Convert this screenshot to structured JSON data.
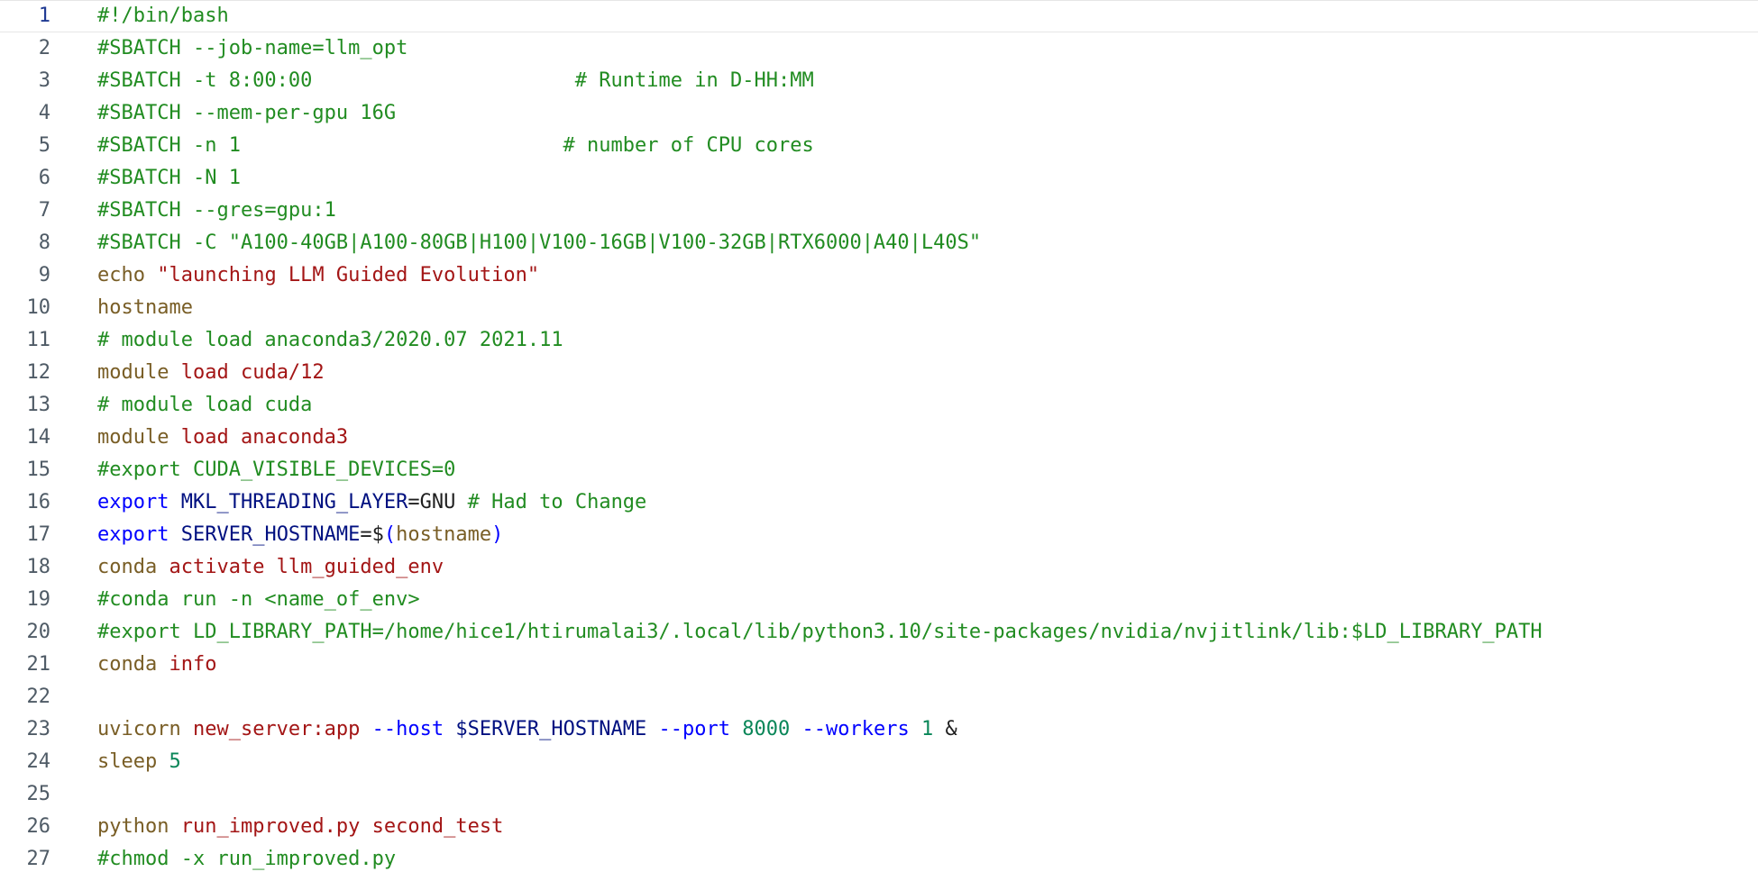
{
  "colors": {
    "comment": "#218c21",
    "keyword": "#795e26",
    "string": "#a31515",
    "flag": "#0000ff",
    "variable": "#001080",
    "number": "#098658",
    "plain": "#1f1f1f",
    "line_number": "#4f5b66",
    "background": "#ffffff"
  },
  "lines": [
    {
      "num": "1",
      "tokens": [
        {
          "t": "#!/bin/bash",
          "c": "cm"
        }
      ]
    },
    {
      "num": "2",
      "tokens": [
        {
          "t": "#SBATCH --job-name=llm_opt",
          "c": "cm"
        }
      ]
    },
    {
      "num": "3",
      "tokens": [
        {
          "t": "#SBATCH -t 8:00:00                      # Runtime in D-HH:MM",
          "c": "cm"
        }
      ]
    },
    {
      "num": "4",
      "tokens": [
        {
          "t": "#SBATCH --mem-per-gpu 16G",
          "c": "cm"
        }
      ]
    },
    {
      "num": "5",
      "tokens": [
        {
          "t": "#SBATCH -n 1                           # number of CPU cores",
          "c": "cm"
        }
      ]
    },
    {
      "num": "6",
      "tokens": [
        {
          "t": "#SBATCH -N 1",
          "c": "cm"
        }
      ]
    },
    {
      "num": "7",
      "tokens": [
        {
          "t": "#SBATCH --gres=gpu:1",
          "c": "cm"
        }
      ]
    },
    {
      "num": "8",
      "tokens": [
        {
          "t": "#SBATCH -C \"A100-40GB|A100-80GB|H100|V100-16GB|V100-32GB|RTX6000|A40|L40S\"",
          "c": "cm"
        }
      ]
    },
    {
      "num": "9",
      "tokens": [
        {
          "t": "echo",
          "c": "ckw"
        },
        {
          "t": " ",
          "c": "cplain"
        },
        {
          "t": "\"launching LLM Guided Evolution\"",
          "c": "cstr"
        }
      ]
    },
    {
      "num": "10",
      "tokens": [
        {
          "t": "hostname",
          "c": "ckw"
        }
      ]
    },
    {
      "num": "11",
      "tokens": [
        {
          "t": "# module load anaconda3/2020.07 2021.11",
          "c": "cm"
        }
      ]
    },
    {
      "num": "12",
      "tokens": [
        {
          "t": "module",
          "c": "ckw"
        },
        {
          "t": " load cuda/12",
          "c": "cstr"
        }
      ]
    },
    {
      "num": "13",
      "tokens": [
        {
          "t": "# module load cuda",
          "c": "cm"
        }
      ]
    },
    {
      "num": "14",
      "tokens": [
        {
          "t": "module",
          "c": "ckw"
        },
        {
          "t": " load anaconda3",
          "c": "cstr"
        }
      ]
    },
    {
      "num": "15",
      "tokens": [
        {
          "t": "#export CUDA_VISIBLE_DEVICES=0",
          "c": "cm"
        }
      ]
    },
    {
      "num": "16",
      "tokens": [
        {
          "t": "export",
          "c": "cblue"
        },
        {
          "t": " MKL_THREADING_LAYER",
          "c": "cnavy"
        },
        {
          "t": "=GNU ",
          "c": "cplain"
        },
        {
          "t": "# Had to Change",
          "c": "cm"
        }
      ]
    },
    {
      "num": "17",
      "tokens": [
        {
          "t": "export",
          "c": "cblue"
        },
        {
          "t": " SERVER_HOSTNAME",
          "c": "cnavy"
        },
        {
          "t": "=$",
          "c": "cplain"
        },
        {
          "t": "(",
          "c": "cblue"
        },
        {
          "t": "hostname",
          "c": "ckw"
        },
        {
          "t": ")",
          "c": "cblue"
        }
      ]
    },
    {
      "num": "18",
      "tokens": [
        {
          "t": "conda",
          "c": "ckw"
        },
        {
          "t": " activate llm_guided_env",
          "c": "cstr"
        }
      ]
    },
    {
      "num": "19",
      "tokens": [
        {
          "t": "#conda run -n <name_of_env>",
          "c": "cm"
        }
      ]
    },
    {
      "num": "20",
      "tokens": [
        {
          "t": "#export LD_LIBRARY_PATH=/home/hice1/htirumalai3/.local/lib/python3.10/site-packages/nvidia/nvjitlink/lib:$LD_LIBRARY_PATH",
          "c": "cm"
        }
      ]
    },
    {
      "num": "21",
      "tokens": [
        {
          "t": "conda",
          "c": "ckw"
        },
        {
          "t": " info",
          "c": "cstr"
        }
      ]
    },
    {
      "num": "22",
      "tokens": []
    },
    {
      "num": "23",
      "tokens": [
        {
          "t": "uvicorn",
          "c": "ckw"
        },
        {
          "t": " new_server:app ",
          "c": "cstr"
        },
        {
          "t": "--host",
          "c": "cblue"
        },
        {
          "t": " $SERVER_HOSTNAME ",
          "c": "cnavy"
        },
        {
          "t": "--port",
          "c": "cblue"
        },
        {
          "t": " 8000 ",
          "c": "cnum"
        },
        {
          "t": "--workers",
          "c": "cblue"
        },
        {
          "t": " 1",
          "c": "cnum"
        },
        {
          "t": " &",
          "c": "cplain"
        }
      ]
    },
    {
      "num": "24",
      "tokens": [
        {
          "t": "sleep",
          "c": "ckw"
        },
        {
          "t": " 5",
          "c": "cnum"
        }
      ]
    },
    {
      "num": "25",
      "tokens": []
    },
    {
      "num": "26",
      "tokens": [
        {
          "t": "python",
          "c": "ckw"
        },
        {
          "t": " run_improved.py second_test",
          "c": "cstr"
        }
      ]
    },
    {
      "num": "27",
      "tokens": [
        {
          "t": "#chmod -x run_improved.py",
          "c": "cm"
        }
      ]
    }
  ]
}
